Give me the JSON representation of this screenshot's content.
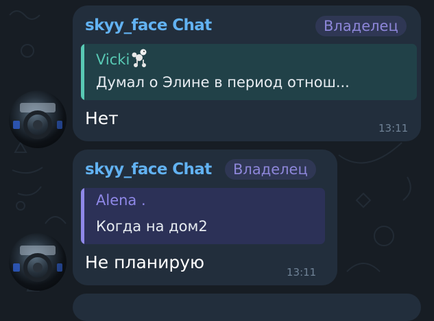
{
  "theme": {
    "background": "#171d24",
    "bubble": "#222e3c",
    "sender_color": "#62b2f2",
    "badge_bg": "#2f3754",
    "badge_text": "#8d86d9"
  },
  "messages": [
    {
      "sender": "skyy_face Chat",
      "badge": "Владелец",
      "reply": {
        "author": "Vicki",
        "author_icon": "poodle-emoji-icon",
        "text": "Думал о Элине в период отнош...",
        "accent": "#58c9b4",
        "bg": "#214148"
      },
      "text": "Нет",
      "time": "13:11"
    },
    {
      "sender": "skyy_face Chat",
      "badge": "Владелец",
      "reply": {
        "author": "Alena .",
        "text": "Когда на дом2",
        "accent": "#8f88e8",
        "bg": "#2c3157"
      },
      "text": "Не планирую",
      "time": "13:11"
    }
  ]
}
